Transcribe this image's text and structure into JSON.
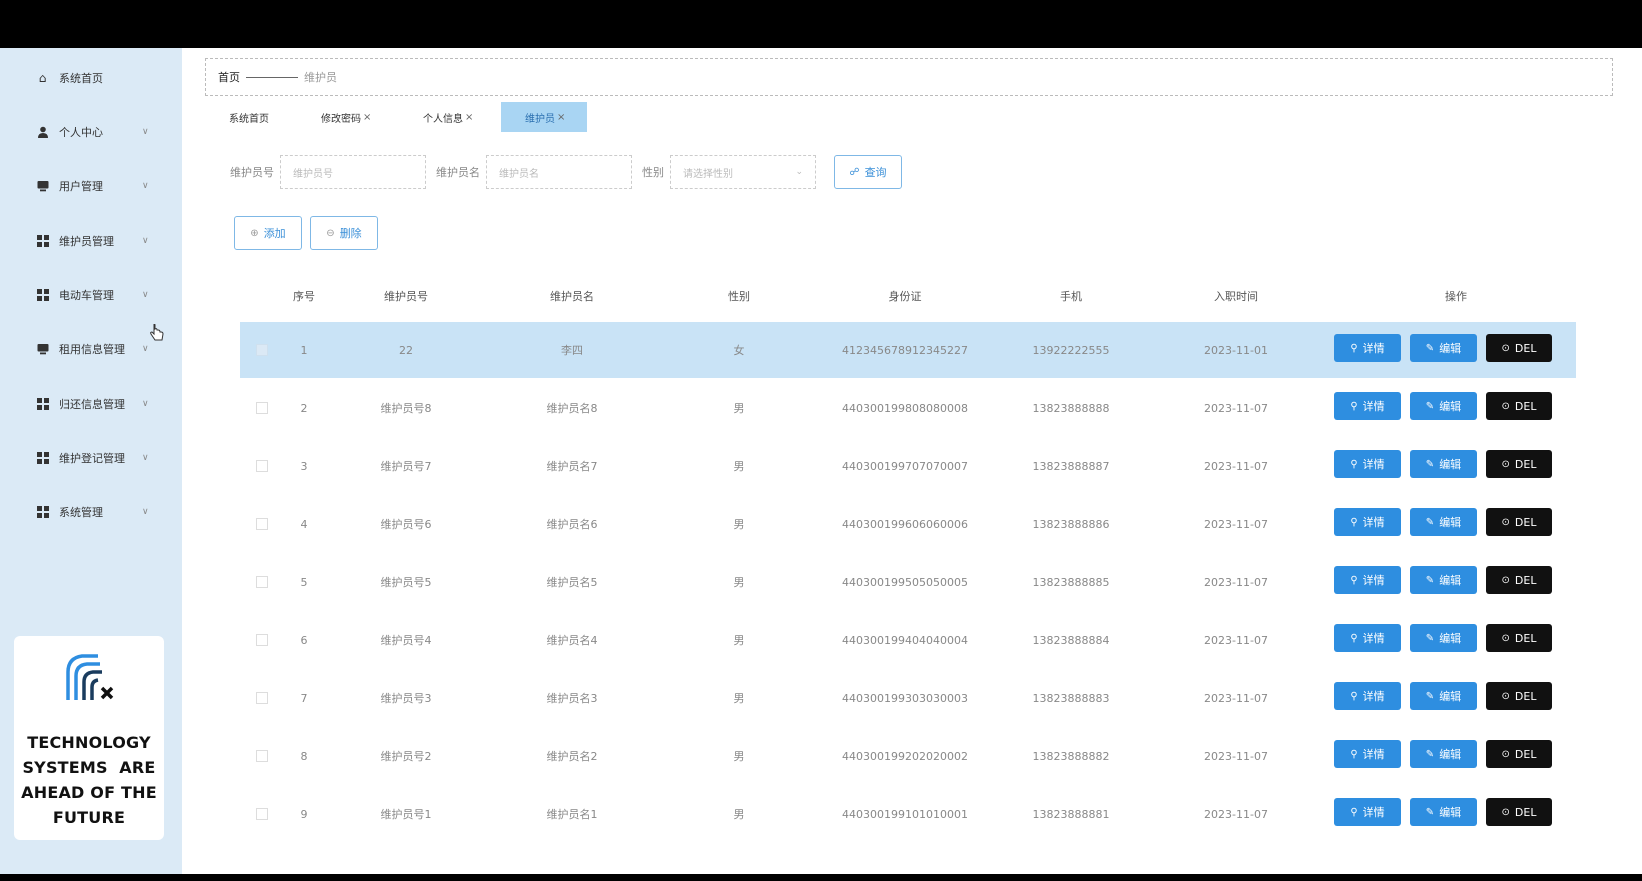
{
  "sidebar": {
    "items": [
      {
        "label": "系统首页",
        "icon": "home-icon",
        "has_chevron": false
      },
      {
        "label": "个人中心",
        "icon": "user-icon",
        "has_chevron": true
      },
      {
        "label": "用户管理",
        "icon": "monitor-icon",
        "has_chevron": true
      },
      {
        "label": "维护员管理",
        "icon": "grid-icon",
        "has_chevron": true
      },
      {
        "label": "电动车管理",
        "icon": "grid-icon",
        "has_chevron": true
      },
      {
        "label": "租用信息管理",
        "icon": "monitor-icon",
        "has_chevron": true
      },
      {
        "label": "归还信息管理",
        "icon": "grid-icon",
        "has_chevron": true
      },
      {
        "label": "维护登记管理",
        "icon": "grid-icon",
        "has_chevron": true
      },
      {
        "label": "系统管理",
        "icon": "grid-icon",
        "has_chevron": true
      }
    ],
    "logo_text": [
      "TECHNOLOGY",
      "SYSTEMS  ARE",
      "AHEAD OF THE",
      "FUTURE"
    ],
    "logo_color": "#2e8ee0"
  },
  "breadcrumb": {
    "home": "首页",
    "current": "维护员"
  },
  "tabs": [
    {
      "label": "系统首页",
      "closable": false,
      "active": false
    },
    {
      "label": "修改密码",
      "closable": true,
      "active": false
    },
    {
      "label": "个人信息",
      "closable": true,
      "active": false
    },
    {
      "label": "维护员",
      "closable": true,
      "active": true
    }
  ],
  "search": {
    "fields": [
      {
        "label": "维护员号",
        "placeholder": "维护员号"
      },
      {
        "label": "维护员名",
        "placeholder": "维护员名"
      },
      {
        "label": "性别",
        "placeholder": "请选择性别"
      }
    ],
    "query_label": "查询"
  },
  "actions": {
    "add_label": "添加",
    "delete_label": "删除"
  },
  "table": {
    "columns": [
      "序号",
      "维护员号",
      "维护员名",
      "性别",
      "身份证",
      "手机",
      "入职时间",
      "操作"
    ],
    "rows": [
      [
        "1",
        "22",
        "李四",
        "女",
        "412345678912345227",
        "13922222555",
        "2023-11-01"
      ],
      [
        "2",
        "维护员号8",
        "维护员名8",
        "男",
        "440300199808080008",
        "13823888888",
        "2023-11-07"
      ],
      [
        "3",
        "维护员号7",
        "维护员名7",
        "男",
        "440300199707070007",
        "13823888887",
        "2023-11-07"
      ],
      [
        "4",
        "维护员号6",
        "维护员名6",
        "男",
        "440300199606060006",
        "13823888886",
        "2023-11-07"
      ],
      [
        "5",
        "维护员号5",
        "维护员名5",
        "男",
        "440300199505050005",
        "13823888885",
        "2023-11-07"
      ],
      [
        "6",
        "维护员号4",
        "维护员名4",
        "男",
        "440300199404040004",
        "13823888884",
        "2023-11-07"
      ],
      [
        "7",
        "维护员号3",
        "维护员名3",
        "男",
        "440300199303030003",
        "13823888883",
        "2023-11-07"
      ],
      [
        "8",
        "维护员号2",
        "维护员名2",
        "男",
        "440300199202020002",
        "13823888882",
        "2023-11-07"
      ],
      [
        "9",
        "维护员号1",
        "维护员名1",
        "男",
        "440300199101010001",
        "13823888881",
        "2023-11-07"
      ]
    ],
    "selected_row": 0,
    "ops": {
      "detail": "详情",
      "edit": "编辑",
      "del": "DEL"
    }
  },
  "colors": {
    "accent": "#2e8ee0",
    "sidebar_bg": "#dbeaf6",
    "selected_row": "#c9e3f6",
    "del_button": "#111111"
  }
}
